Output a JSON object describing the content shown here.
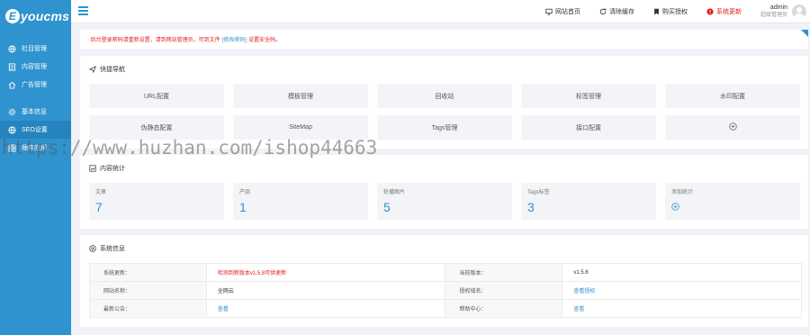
{
  "sidebar": {
    "logo": "youcms",
    "logo_letter": "E",
    "items": [
      {
        "label": "栏目管理",
        "icon": "globe-icon"
      },
      {
        "label": "内容管理",
        "icon": "document-icon"
      },
      {
        "label": "广告管理",
        "icon": "home-icon"
      },
      {
        "label": "基本信息",
        "icon": "gear-icon"
      },
      {
        "label": "SEO设置",
        "icon": "globe-icon",
        "active": true
      },
      {
        "label": "插件应用",
        "icon": "puzzle-icon"
      }
    ]
  },
  "topbar": {
    "links": [
      {
        "label": "网站首页",
        "icon": "monitor-icon"
      },
      {
        "label": "清除缓存",
        "icon": "refresh-icon"
      },
      {
        "label": "购买授权",
        "icon": "bookmark-icon"
      },
      {
        "label": "系统更新",
        "icon": "alert-icon",
        "color": "#e02020"
      }
    ],
    "user": {
      "name": "admin",
      "role": "超级管理员"
    }
  },
  "notice": {
    "prefix": "· 后台登录密码请重新设置，请到网站管理员，可到文件",
    "link": "[修改密码]",
    "suffix": "设置安全码。"
  },
  "quick_nav": {
    "title": "快捷导航",
    "items": [
      "URL配置",
      "模板管理",
      "回收站",
      "标签管理",
      "水印配置",
      "伪静态配置",
      "SiteMap",
      "Tags管理",
      "接口配置",
      "+"
    ]
  },
  "stats": {
    "title": "内容统计",
    "items": [
      {
        "label": "文章",
        "value": "7"
      },
      {
        "label": "产品",
        "value": "1"
      },
      {
        "label": "轮播图片",
        "value": "5"
      },
      {
        "label": "Tags标签",
        "value": "3"
      },
      {
        "label": "添加统计",
        "value": ""
      }
    ]
  },
  "sysinfo": {
    "title": "系统信息",
    "rows": [
      {
        "k1": "系统更新：",
        "v1": "检测到新版本v1.5.8可供更新",
        "k2": "当前版本：",
        "v2": "v1.5.6"
      },
      {
        "k1": "网站名称：",
        "v1": "全网云",
        "k2": "授权域名：",
        "v2": "查看授权"
      },
      {
        "k1": "最新公告：",
        "v1": "查看",
        "k2": "帮助中心：",
        "v2": "查看"
      }
    ]
  },
  "watermark": "https://www.huzhan.com/ishop44663",
  "colors": {
    "accent": "#2f93cf",
    "sidebar_active": "#2583bd",
    "alert": "#e02020"
  }
}
